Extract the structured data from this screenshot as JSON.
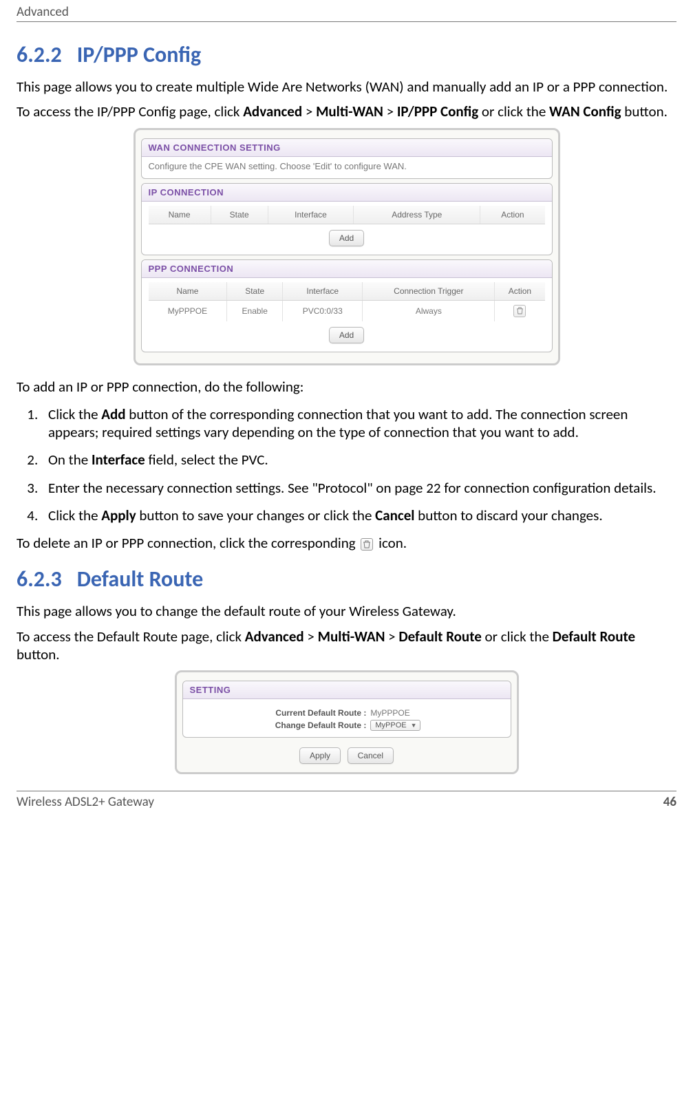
{
  "page_header": {
    "left": "Advanced"
  },
  "section_622": {
    "num": "6.2.2",
    "title": "IP/PPP Config",
    "p1": "This page allows you to create multiple Wide Are Networks (WAN) and manually add an IP or a PPP connection.",
    "p2_pre": "To access the IP/PPP Config page, click ",
    "p2_b1": "Advanced",
    "p2_sep": " > ",
    "p2_b2": "Multi-WAN",
    "p2_b3": "IP/PPP Config",
    "p2_mid": " or click the ",
    "p2_b4": "WAN Config",
    "p2_post": " button."
  },
  "screenshot1": {
    "wan_box": {
      "title": "WAN CONNECTION SETTING",
      "subtitle": "Configure the CPE WAN setting. Choose 'Edit' to configure WAN."
    },
    "ip_box": {
      "title": "IP CONNECTION",
      "cols": [
        "Name",
        "State",
        "Interface",
        "Address Type",
        "Action"
      ],
      "add": "Add"
    },
    "ppp_box": {
      "title": "PPP CONNECTION",
      "cols": [
        "Name",
        "State",
        "Interface",
        "Connection Trigger",
        "Action"
      ],
      "row": {
        "name": "MyPPPOE",
        "state": "Enable",
        "iface": "PVC0:0/33",
        "trig": "Always"
      },
      "add": "Add"
    }
  },
  "mid_para": "To add an IP or PPP connection, do the following:",
  "steps": {
    "s1_pre": "Click the ",
    "s1_b": "Add",
    "s1_post": " button of the corresponding connection that you want to add. The connection screen appears; required settings vary depending on the type of connection that you want to add.",
    "s2_pre": "On the ",
    "s2_b": "Interface",
    "s2_post": " field, select the PVC.",
    "s3": "Enter the necessary connection settings. See \"Protocol\" on page 22 for connection configuration details.",
    "s4_pre": "Click the ",
    "s4_b1": "Apply",
    "s4_mid": " button to save your changes or click the ",
    "s4_b2": "Cancel",
    "s4_post": " button to discard your changes."
  },
  "delete_line": {
    "pre": "To delete an IP or PPP connection, click the corresponding ",
    "post": " icon."
  },
  "section_623": {
    "num": "6.2.3",
    "title": "Default Route",
    "p1": "This page allows you to change the default route of your Wireless Gateway.",
    "p2_pre": "To access the Default Route page, click ",
    "p2_b1": "Advanced",
    "p2_sep": " > ",
    "p2_b2": "Multi-WAN",
    "p2_b3": "Default Route",
    "p2_mid": " or click the ",
    "p2_b4": "Default Route",
    "p2_post": " button."
  },
  "screenshot2": {
    "title": "SETTING",
    "row1_lbl": "Current Default Route   :",
    "row1_val": "MyPPPOE",
    "row2_lbl": "Change Default Route   :",
    "row2_val": "MyPPOE",
    "apply": "Apply",
    "cancel": "Cancel"
  },
  "footer": {
    "left": "Wireless ADSL2+ Gateway",
    "right": "46"
  }
}
